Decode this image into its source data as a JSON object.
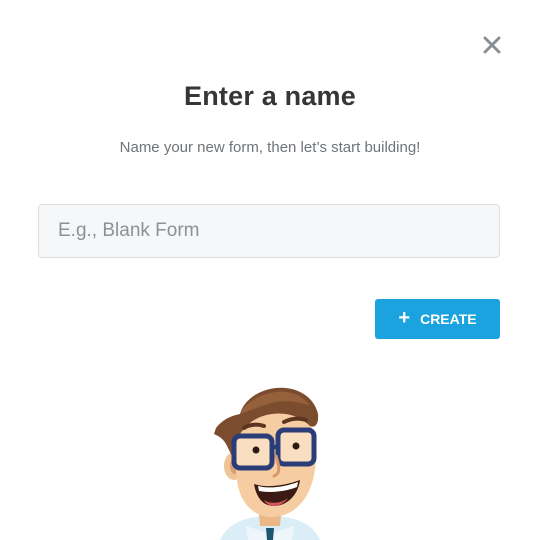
{
  "dialog": {
    "title": "Enter a name",
    "subtitle": "Name your new form, then let’s start building!",
    "close_icon": "close-icon"
  },
  "name_input": {
    "value": "",
    "placeholder": "E.g., Blank Form"
  },
  "create_button": {
    "icon": "+",
    "label": "CREATE",
    "color": "#1ba3e0"
  },
  "mascot": {
    "icon": "mascot-illustration"
  }
}
